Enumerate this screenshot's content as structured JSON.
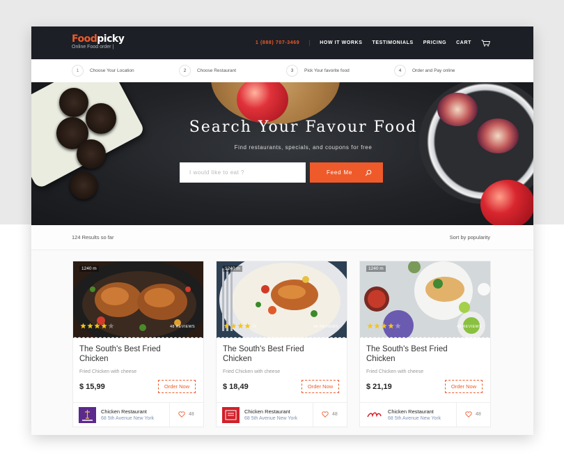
{
  "header": {
    "logo_accent": "Food",
    "logo_rest": "picky",
    "logo_sub": "Online Food order |",
    "phone": "1 (888) 707-3469",
    "nav": [
      "HOW IT WORKS",
      "TESTIMONIALS",
      "PRICING",
      "CART"
    ]
  },
  "steps": [
    {
      "num": "1",
      "label": "Choose Your Location"
    },
    {
      "num": "2",
      "label": "Choose Restaurant"
    },
    {
      "num": "3",
      "label": "Pick Your favorite food"
    },
    {
      "num": "4",
      "label": "Order and Pay online"
    }
  ],
  "hero": {
    "title": "Search Your Favour Food",
    "subtitle": "Find restaurants, specials, and coupons for free",
    "search_placeholder": "I would like to eat ?",
    "button_label": "Feed Me"
  },
  "results": {
    "count_label": "124 Results so far",
    "sort_label": "Sort by popularity"
  },
  "cards": [
    {
      "distance": "1240 m",
      "rating": 4,
      "reviews": "48 REVIEWS",
      "title": "The South's Best Fried Chicken",
      "description": "Fried Chicken with cheese",
      "price": "$ 15,99",
      "order_label": "Order Now",
      "restaurant_name": "Chicken Restaurant",
      "restaurant_address": "68 5th Avenue New York",
      "likes": "48",
      "logo_color": "#5b2a8c"
    },
    {
      "distance": "1240 m",
      "rating": 4,
      "reviews": "48 REVIEWS",
      "title": "The South's Best Fried Chicken",
      "description": "Fried Chicken with cheese",
      "price": "$ 18,49",
      "order_label": "Order Now",
      "restaurant_name": "Chicken Restaurant",
      "restaurant_address": "68 5th Avenue New York",
      "likes": "48",
      "logo_color": "#d1202a"
    },
    {
      "distance": "1240 m",
      "rating": 4,
      "reviews": "48 REVIEWS",
      "title": "The South's Best Fried Chicken",
      "description": "Fried Chicken with cheese",
      "price": "$ 21,19",
      "order_label": "Order Now",
      "restaurant_name": "Chicken Restaurant",
      "restaurant_address": "68 5th Avenue New York",
      "likes": "48",
      "logo_color": "#d8232a"
    }
  ],
  "colors": {
    "accent": "#ef5a2a",
    "header_bg": "#1c1f25",
    "address_text": "#7f94b5",
    "star": "#f5c518"
  }
}
